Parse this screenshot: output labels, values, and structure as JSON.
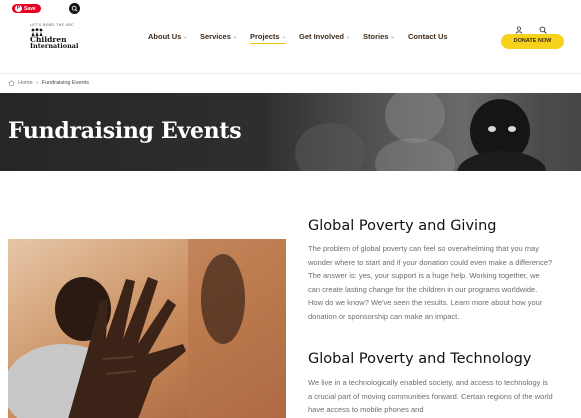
{
  "overlay": {
    "pin_save_label": "Save",
    "pin_icon": "pinterest-icon",
    "lens_icon": "search-lens-icon"
  },
  "logo": {
    "arc_text": "LET'S BEND THE ARC",
    "line1": "Children",
    "line2": "International",
    "icon": "children-international-logo-icon"
  },
  "nav": {
    "items": [
      {
        "label": "About Us",
        "has_caret": true
      },
      {
        "label": "Services",
        "has_caret": true
      },
      {
        "label": "Projects",
        "has_caret": true,
        "active": true
      },
      {
        "label": "Get Involved",
        "has_caret": true
      },
      {
        "label": "Stories",
        "has_caret": true
      },
      {
        "label": "Contact Us",
        "has_caret": false
      }
    ],
    "caret": "⌄"
  },
  "header": {
    "account_icon": "user-icon",
    "search_icon": "search-icon",
    "donate_label": "DONATE NOW"
  },
  "colors": {
    "accent": "#f7d21a",
    "nav_text": "#3d2b1a",
    "body_text": "#6e6e6e"
  },
  "breadcrumb": {
    "home_icon": "home-icon",
    "home": "Home",
    "separator": "»",
    "current": "Fundraising Events"
  },
  "hero": {
    "title": "Fundraising Events"
  },
  "sections": [
    {
      "title": "Global Poverty and Giving",
      "body": "The problem of global poverty can feel so overwhelming that you may wonder where to start and if your donation could even make a difference? The answer is: yes, your support is a huge help. Working together, we can create lasting change for the children in our programs worldwide. How do we know? We've seen the results. Learn more about how your donation or sponsorship can make an impact."
    },
    {
      "title": "Global Poverty and Technology",
      "body": "We live in a technologically enabled society, and access to technology is a crucial part of moving communities forward. Certain regions of the world have access to mobile phones and"
    }
  ]
}
